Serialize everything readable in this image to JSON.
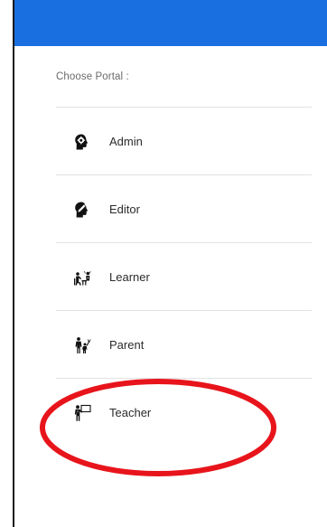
{
  "header": {
    "color": "#1a6fe0"
  },
  "portal_prompt": "Choose Portal :",
  "portals": [
    {
      "label": "Admin",
      "icon": "head-gear-icon"
    },
    {
      "label": "Editor",
      "icon": "head-pen-icon"
    },
    {
      "label": "Learner",
      "icon": "learner-icon"
    },
    {
      "label": "Parent",
      "icon": "parent-child-icon"
    },
    {
      "label": "Teacher",
      "icon": "teacher-board-icon"
    }
  ],
  "annotation": {
    "shape": "ellipse",
    "color": "#e8141b",
    "target": "Teacher"
  }
}
